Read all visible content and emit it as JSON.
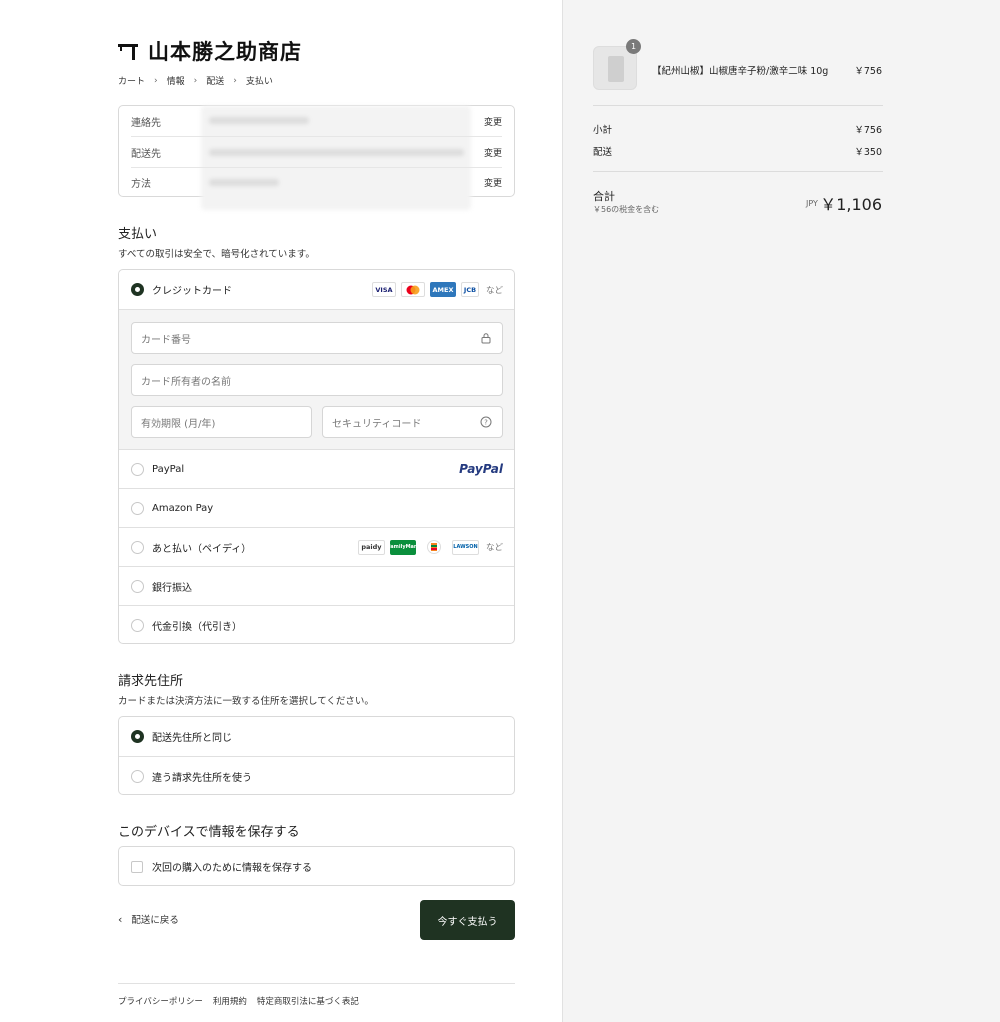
{
  "store": {
    "name": "山本勝之助商店"
  },
  "breadcrumb": [
    "カート",
    "情報",
    "配送",
    "支払い"
  ],
  "review": {
    "rows": [
      {
        "label": "連絡先",
        "change": "変更"
      },
      {
        "label": "配送先",
        "change": "変更"
      },
      {
        "label": "方法",
        "change": "変更"
      }
    ]
  },
  "payment": {
    "title": "支払い",
    "subtitle": "すべての取引は安全で、暗号化されています。",
    "credit_card": {
      "label": "クレジットカード",
      "brands": [
        "VISA",
        "AMEX",
        "JCB"
      ],
      "etc": "など",
      "card_number_placeholder": "カード番号",
      "card_name_placeholder": "カード所有者の名前",
      "expiry_placeholder": "有効期限 (月/年)",
      "security_placeholder": "セキュリティコード"
    },
    "paypal": {
      "label": "PayPal",
      "logo": "PayPal"
    },
    "amazon": {
      "label": "Amazon Pay"
    },
    "paidy": {
      "label": "あと払い（ペイディ）",
      "brands": [
        "paidy",
        "FamilyMart",
        "LAWSON"
      ],
      "etc": "など"
    },
    "bank": {
      "label": "銀行振込"
    },
    "cod": {
      "label": "代金引換（代引き）"
    }
  },
  "billing": {
    "title": "請求先住所",
    "subtitle": "カードまたは決済方法に一致する住所を選択してください。",
    "same": "配送先住所と同じ",
    "different": "違う請求先住所を使う"
  },
  "save_info": {
    "title": "このデバイスで情報を保存する",
    "checkbox": "次回の購入のために情報を保存する"
  },
  "actions": {
    "back": "配送に戻る",
    "pay": "今すぐ支払う"
  },
  "footer": [
    "プライバシーポリシー",
    "利用規約",
    "特定商取引法に基づく表記"
  ],
  "summary": {
    "item": {
      "name": "【紀州山椒】山椒唐辛子粉/激辛二味 10g",
      "price": "￥756",
      "quantity": "1"
    },
    "subtotal_label": "小計",
    "subtotal": "￥756",
    "shipping_label": "配送",
    "shipping": "￥350",
    "total_label": "合計",
    "tax_note": "￥56の税金を含む",
    "currency": "JPY",
    "total": "￥1,106"
  },
  "colors": {
    "accent": "#1f3322"
  }
}
